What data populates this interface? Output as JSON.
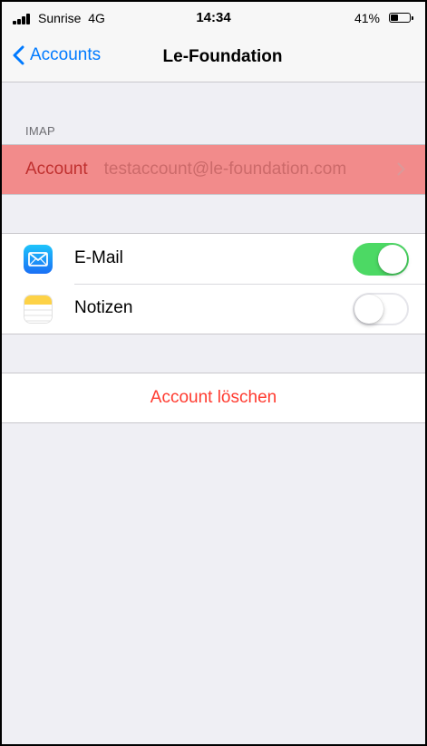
{
  "status_bar": {
    "carrier": "Sunrise",
    "network": "4G",
    "time": "14:34",
    "battery": "41%",
    "battery_level": 0.41
  },
  "nav": {
    "back_label": "Accounts",
    "title": "Le-Foundation"
  },
  "imap_section": {
    "header": "IMAP",
    "account_label": "Account",
    "account_value": "testaccount@le-foundation.com"
  },
  "services": [
    {
      "label": "E-Mail",
      "icon": "mail-icon",
      "enabled": true
    },
    {
      "label": "Notizen",
      "icon": "notes-icon",
      "enabled": false
    }
  ],
  "delete_button": "Account löschen",
  "colors": {
    "accent": "#007aff",
    "toggle_on": "#4cd964",
    "destructive": "#ff3b30",
    "highlight": "#f28b8b"
  }
}
